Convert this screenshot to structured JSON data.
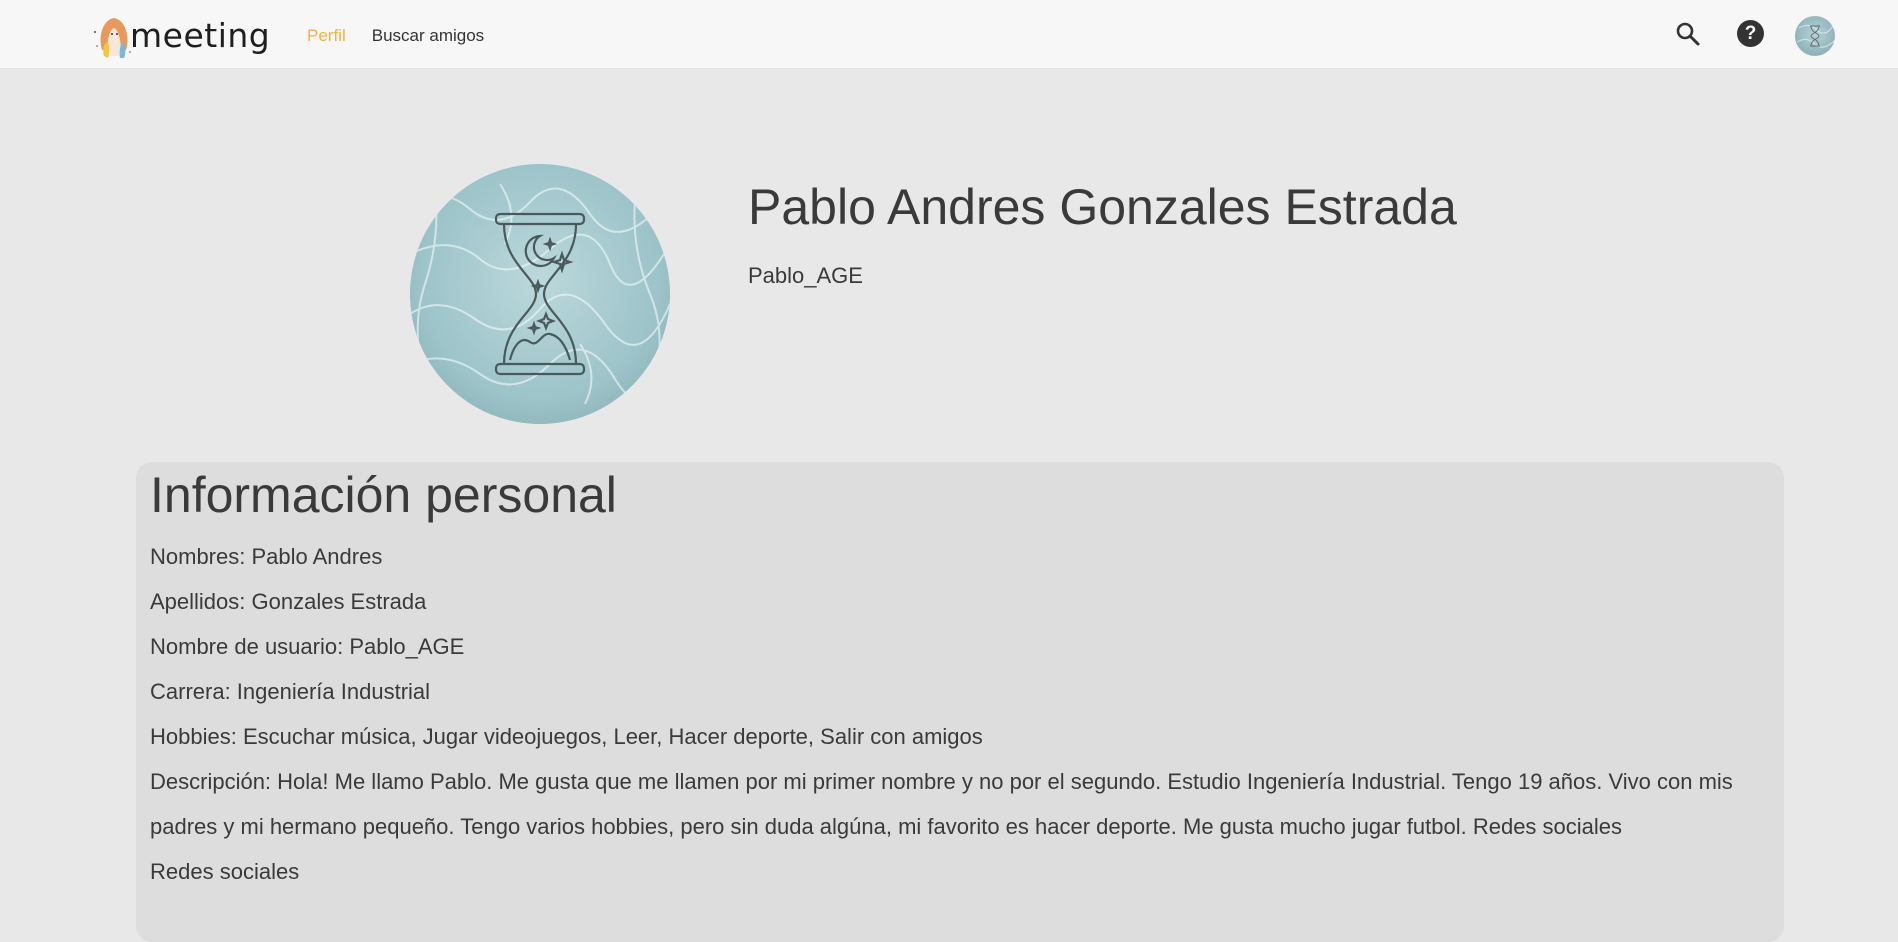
{
  "header": {
    "logo_text": "meeting",
    "nav": [
      {
        "label": "Perfil",
        "active": true
      },
      {
        "label": "Buscar amigos",
        "active": false
      }
    ],
    "icons": {
      "search": "search-icon",
      "help": "help-icon",
      "avatar": "user-avatar"
    }
  },
  "profile": {
    "full_name": "Pablo Andres Gonzales Estrada",
    "username": "Pablo_AGE"
  },
  "personal_info": {
    "title": "Información personal",
    "lines": [
      "Nombres: Pablo Andres",
      "Apellidos: Gonzales Estrada",
      "Nombre de usuario: Pablo_AGE",
      "Carrera: Ingeniería Industrial",
      "Hobbies: Escuchar música, Jugar videojuegos, Leer, Hacer deporte, Salir con amigos",
      "Descripción: Hola! Me llamo Pablo. Me gusta que me llamen por mi primer nombre y no por el segundo. Estudio Ingeniería Industrial. Tengo 19 años. Vivo con mis padres y mi hermano pequeño. Tengo varios hobbies, pero sin duda algúna, mi favorito es hacer deporte. Me gusta mucho jugar futbol. Redes sociales",
      "Redes sociales"
    ]
  },
  "colors": {
    "accent": "#f2b33d",
    "background": "#e8e8e8",
    "topbar": "#f7f7f7",
    "card": "#dddddd",
    "text": "#3a3a3a"
  }
}
